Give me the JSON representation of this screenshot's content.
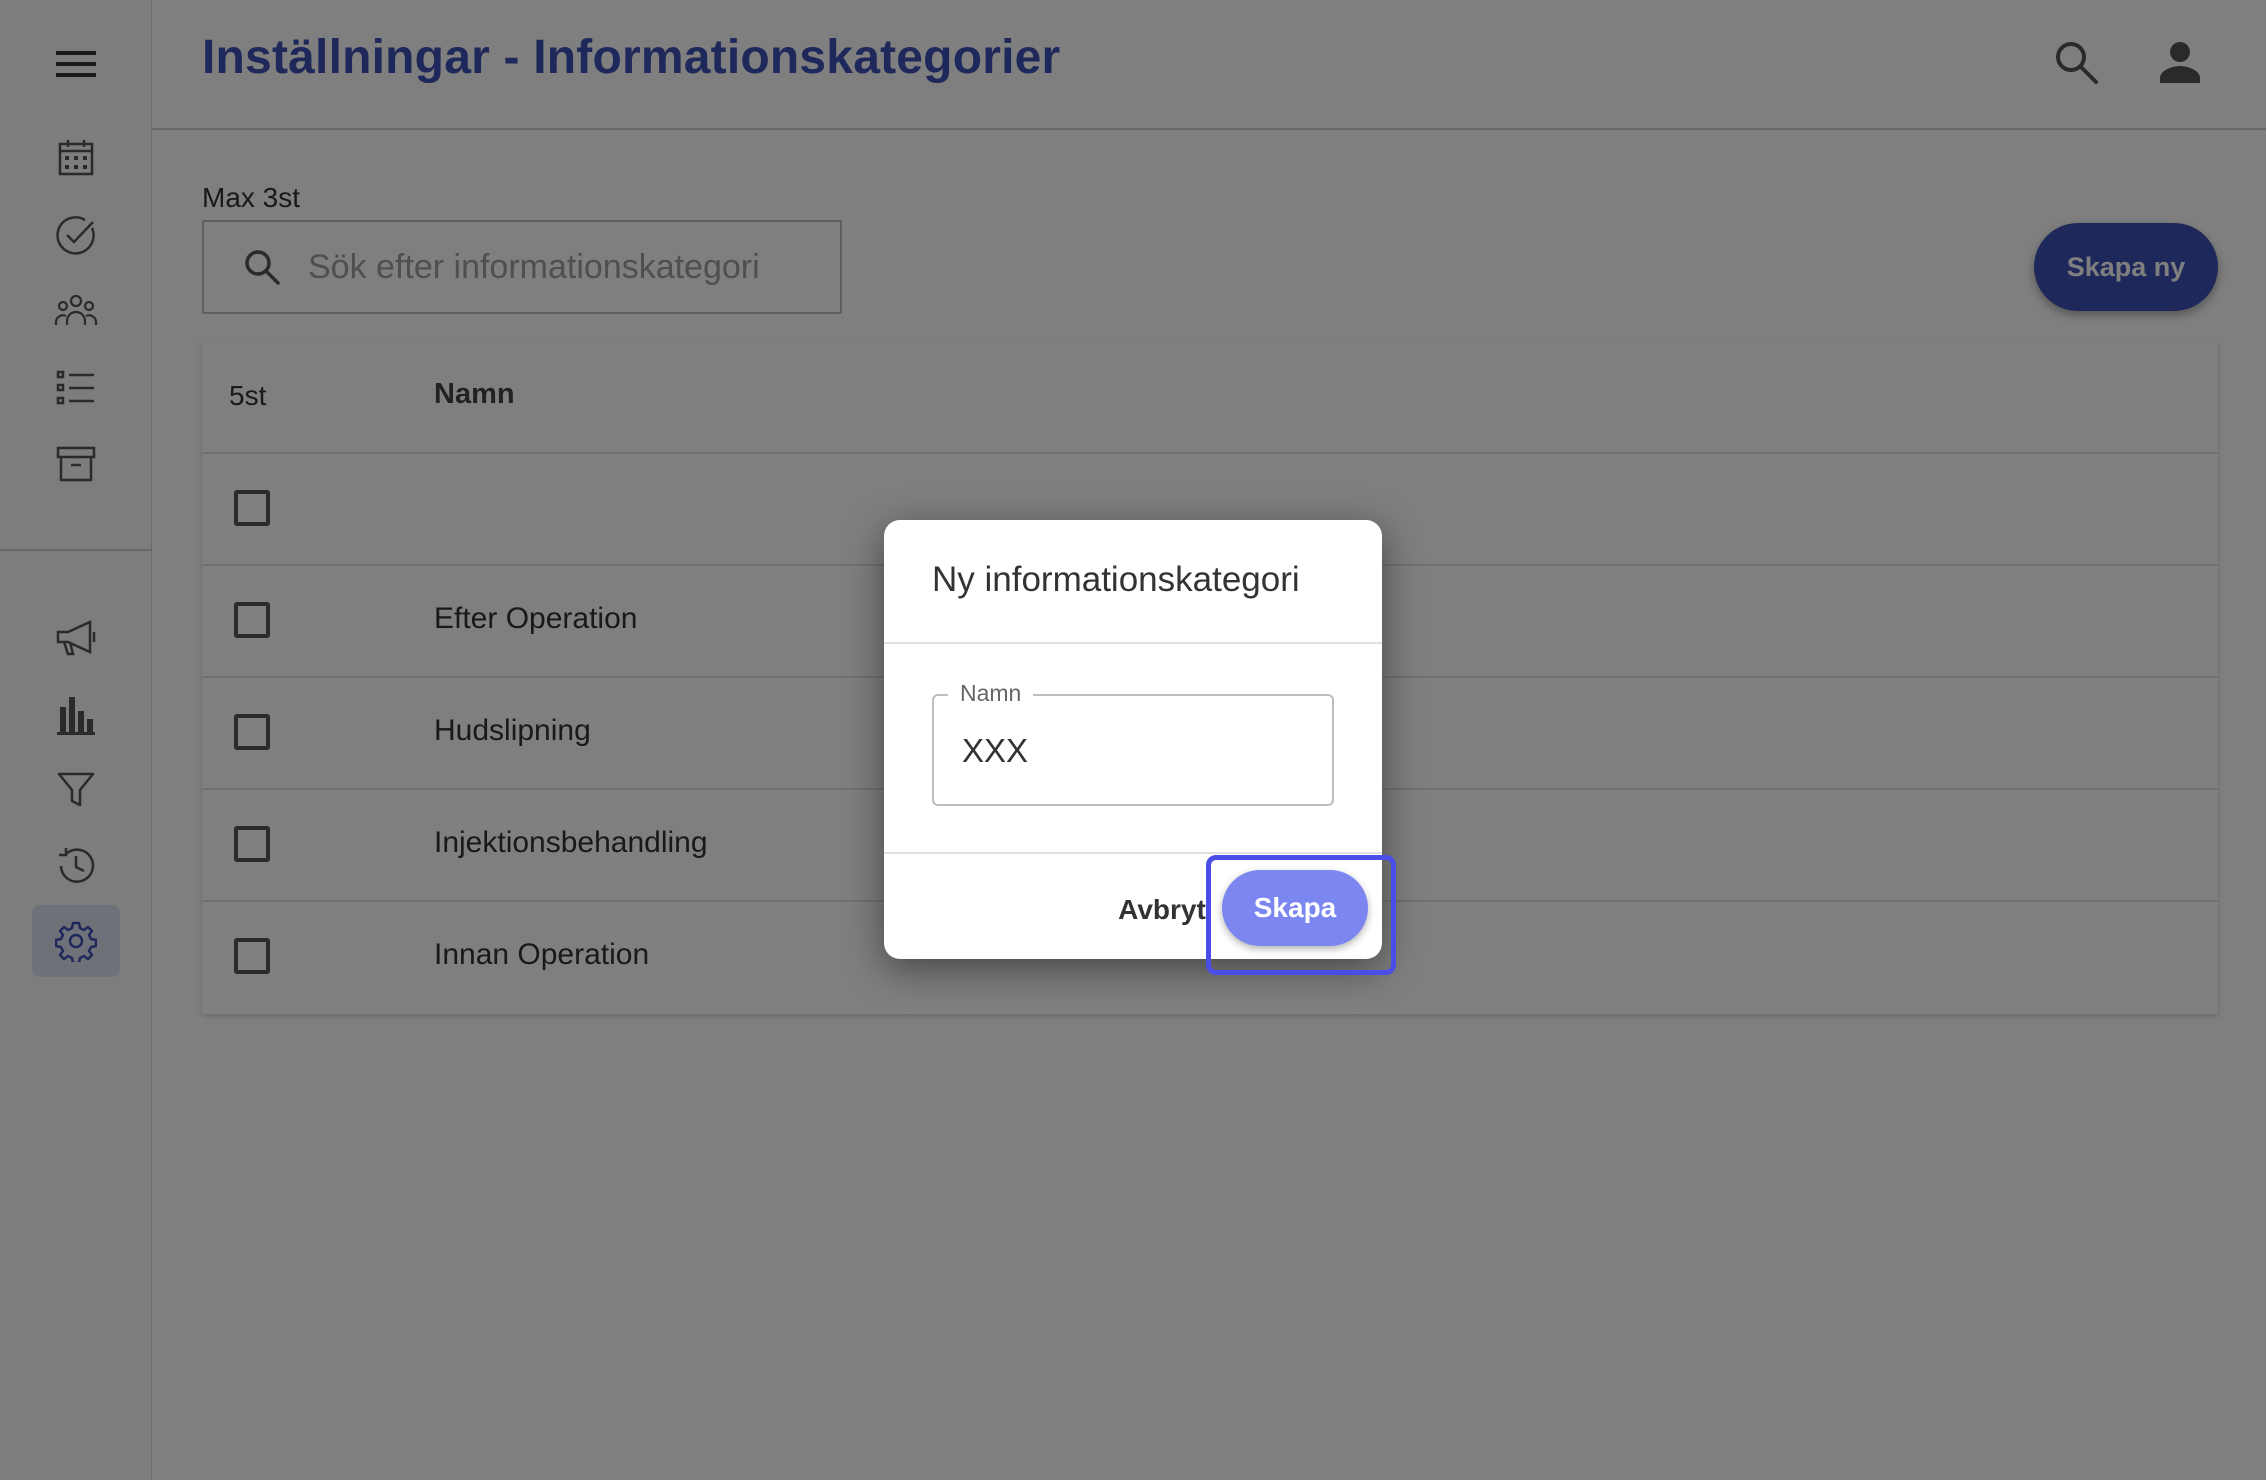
{
  "sidebar": {
    "menu_icon": "hamburger-menu-icon",
    "top_items": [
      {
        "icon": "calendar-icon"
      },
      {
        "icon": "check-circle-icon"
      },
      {
        "icon": "group-icon"
      },
      {
        "icon": "list-icon"
      },
      {
        "icon": "archive-icon"
      }
    ],
    "bottom_items": [
      {
        "icon": "megaphone-icon"
      },
      {
        "icon": "bar-chart-icon"
      },
      {
        "icon": "filter-icon"
      },
      {
        "icon": "history-icon"
      },
      {
        "icon": "gear-icon",
        "active": true
      }
    ]
  },
  "header": {
    "title": "Inställningar - Informationskategorier",
    "icons": [
      "search-icon",
      "account-icon"
    ]
  },
  "search": {
    "max_label": "Max 3st",
    "placeholder": "Sök efter informationskategori",
    "value": ""
  },
  "toolbar": {
    "create_new_label": "Skapa ny"
  },
  "table": {
    "count_label": "5st",
    "name_header": "Namn",
    "rows": [
      {
        "name": "",
        "checked": false
      },
      {
        "name": "Efter Operation",
        "checked": false
      },
      {
        "name": "Hudslipning",
        "checked": false
      },
      {
        "name": "Injektionsbehandling",
        "checked": false
      },
      {
        "name": "Innan Operation",
        "checked": false
      }
    ]
  },
  "dialog": {
    "title": "Ny informationskategori",
    "field_label": "Namn",
    "field_value": "XXX",
    "cancel_label": "Avbryt",
    "create_label": "Skapa"
  },
  "colors": {
    "primary": "#3f51b5",
    "dialog_button": "#7b86f0",
    "focus_ring": "#4a4ee6",
    "active_nav_bg": "#dfe3f3"
  }
}
